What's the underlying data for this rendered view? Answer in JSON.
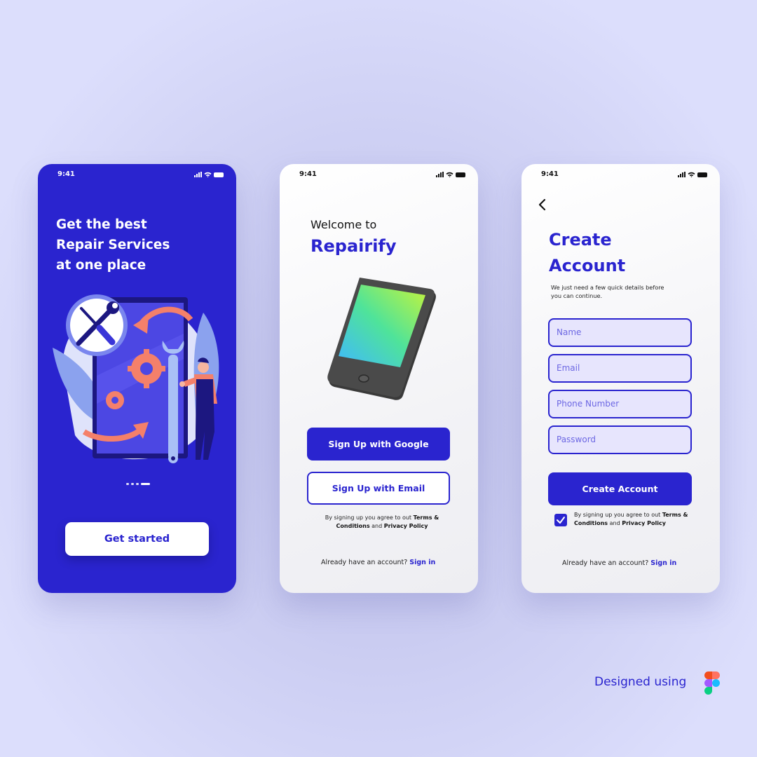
{
  "status_bar": {
    "time": "9:41"
  },
  "onboarding": {
    "headline": [
      "Get the best",
      "Repair Services",
      "at one place"
    ],
    "get_started_label": "Get started"
  },
  "welcome_screen": {
    "welcome_text": "Welcome to",
    "brand": "Repairify",
    "google_button_label": "Sign Up with Google",
    "email_button_label": "Sign Up with Email",
    "terms_prefix": "By signing up you agree to out ",
    "terms_link_1": "Terms &",
    "terms_link_1b": "Conditions",
    "terms_and": " and ",
    "terms_link_2": "Privacy Policy",
    "already_text": "Already have an account? ",
    "sign_in_link": "Sign in"
  },
  "create_account_screen": {
    "title_line1": "Create",
    "title_line2": "Account",
    "subtitle_line1": "We just need a few quick details before",
    "subtitle_line2": "you can continue.",
    "fields": [
      {
        "placeholder": "Name"
      },
      {
        "placeholder": "Email"
      },
      {
        "placeholder": "Phone Number"
      },
      {
        "placeholder": "Password"
      }
    ],
    "create_button_label": "Create Account",
    "terms_checked": true,
    "terms_prefix": "By signing up you agree to out ",
    "terms_link_1": "Terms &",
    "terms_link_1b": "Conditions",
    "terms_and": " and ",
    "terms_link_2": "Privacy Policy",
    "already_text": "Already have an account? ",
    "sign_in_link": "Sign in"
  },
  "footer": {
    "designed_label": "Designed using"
  },
  "colors": {
    "primary": "#2a24cf",
    "field_bg": "#e7e5fd",
    "accent_orange": "#f4806a"
  },
  "icons": [
    "signal-icon",
    "wifi-icon",
    "battery-icon",
    "back-arrow-icon",
    "check-icon",
    "figma-logo-icon",
    "wrench-icon",
    "screwdriver-icon",
    "gear-icon"
  ]
}
